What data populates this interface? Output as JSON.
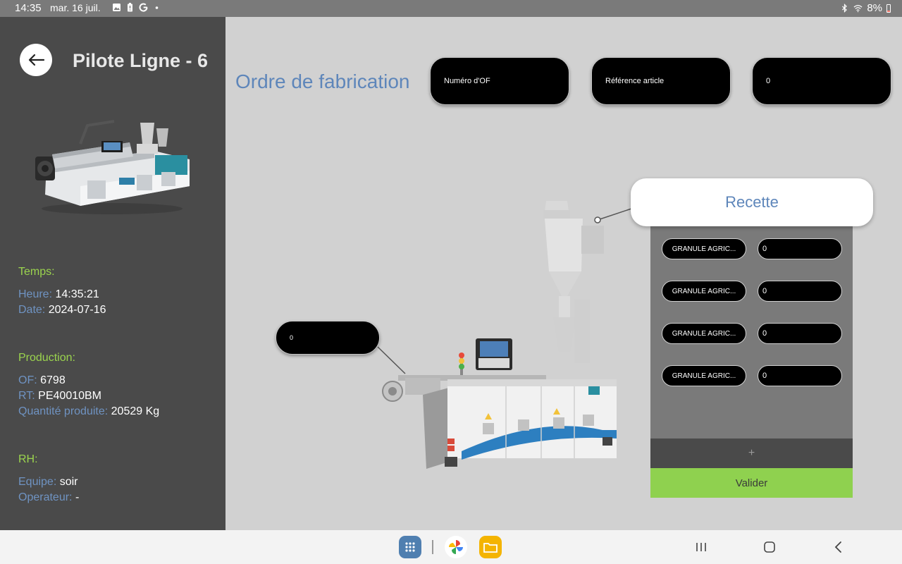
{
  "status_bar": {
    "time": "14:35",
    "date": "mar. 16 juil.",
    "battery": "8%",
    "icons": [
      "gallery-icon",
      "battery-saver-icon",
      "google-icon",
      "dot-icon",
      "bluetooth-icon",
      "wifi-icon",
      "battery-icon"
    ]
  },
  "sidebar": {
    "title": "Pilote Ligne - 6",
    "temps": {
      "heading": "Temps:",
      "heure_label": "Heure:",
      "heure_value": "14:35:21",
      "date_label": "Date:",
      "date_value": "2024-07-16"
    },
    "production": {
      "heading": "Production:",
      "of_label": "OF:",
      "of_value": "6798",
      "rt_label": "RT:",
      "rt_value": "PE40010BM",
      "qty_label": "Quantité produite:",
      "qty_value": "20529 Kg"
    },
    "rh": {
      "heading": "RH:",
      "equipe_label": "Equipe:",
      "equipe_value": "soir",
      "operateur_label": "Operateur:",
      "operateur_value": "-"
    }
  },
  "main": {
    "title": "Ordre de fabrication",
    "field_of_placeholder": "Numéro d'OF",
    "field_ref_placeholder": "Référence article",
    "field_3_value": "0",
    "machine_field_value": "0"
  },
  "recipe": {
    "title": "Recette",
    "ingredients": [
      {
        "name": "GRANULE AGRIC...",
        "qty": "0"
      },
      {
        "name": "GRANULE AGRIC...",
        "qty": "0"
      },
      {
        "name": "GRANULE AGRIC...",
        "qty": "0"
      },
      {
        "name": "GRANULE AGRIC...",
        "qty": "0"
      }
    ],
    "add_label": "+",
    "validate_label": "Valider"
  },
  "colors": {
    "accent_blue": "#5e86ba",
    "accent_green": "#8fd14f",
    "sidebar_bg": "#4a4a4a",
    "main_bg": "#d1d1d1"
  }
}
